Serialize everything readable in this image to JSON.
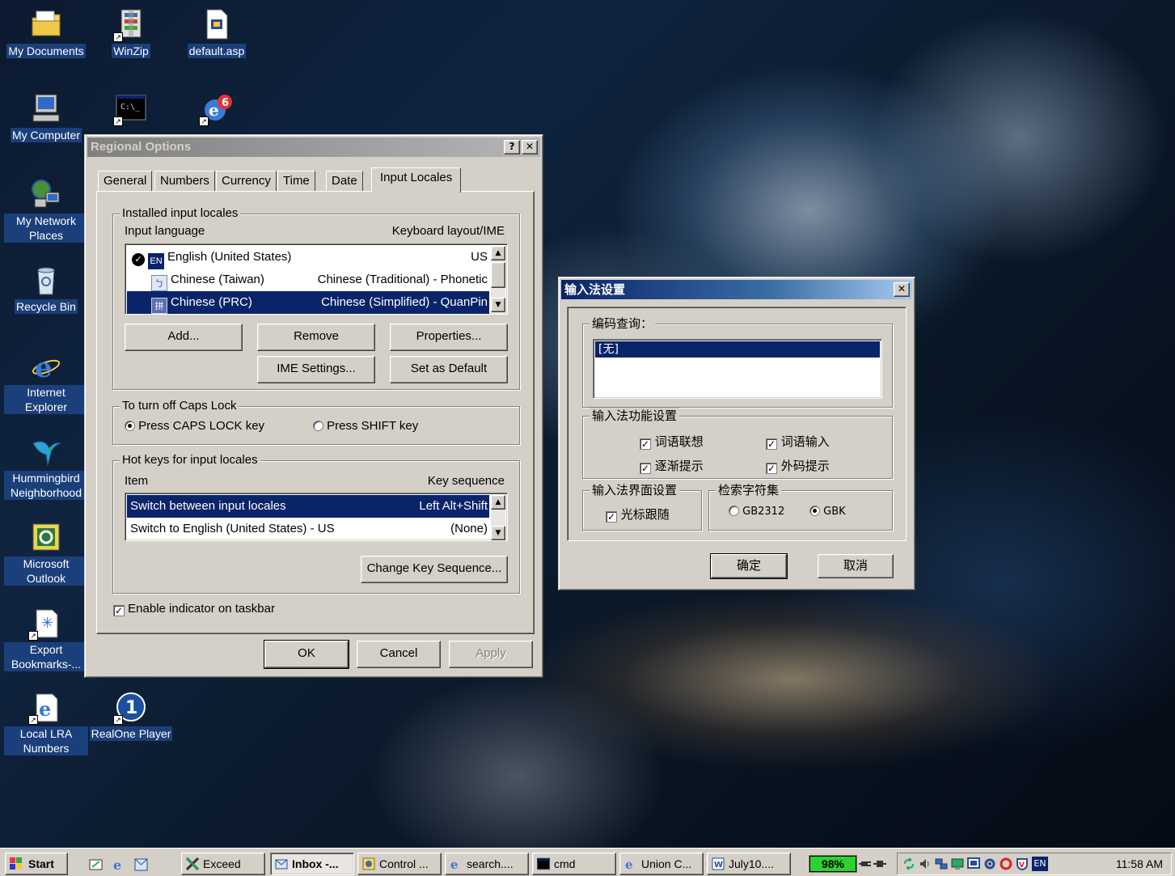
{
  "desktop": {
    "icons": [
      {
        "label": "My Documents"
      },
      {
        "label": "WinZip"
      },
      {
        "label": "default.asp"
      },
      {
        "label": "My Computer"
      },
      {
        "label": "C:\\_"
      },
      {
        "label": "My Network Places"
      },
      {
        "label": "Recycle Bin"
      },
      {
        "label": "Internet Explorer"
      },
      {
        "label": "Hummingbird Neighborhood"
      },
      {
        "label": "Microsoft Outlook"
      },
      {
        "label": "Export Bookmarks-..."
      },
      {
        "label": "Local LRA Numbers"
      },
      {
        "label": "RealOne Player"
      }
    ]
  },
  "regional": {
    "title": "Regional Options",
    "help_btn": "?",
    "close_btn": "✕",
    "tabs": [
      "General",
      "Numbers",
      "Currency",
      "Time",
      "Date",
      "Input Locales"
    ],
    "installed_group": "Installed input locales",
    "col_language": "Input language",
    "col_layout": "Keyboard layout/IME",
    "locales": [
      {
        "flag": "EN",
        "language": "English (United States)",
        "layout": "US",
        "default": true
      },
      {
        "flag": "",
        "language": "Chinese (Taiwan)",
        "layout": "Chinese (Traditional) - Phonetic"
      },
      {
        "flag": "",
        "language": "Chinese (PRC)",
        "layout": "Chinese (Simplified) - QuanPin"
      }
    ],
    "btn_add": "Add...",
    "btn_remove": "Remove",
    "btn_properties": "Properties...",
    "btn_ime": "IME Settings...",
    "btn_default": "Set as Default",
    "caps_group": "To turn off Caps Lock",
    "radio_caps": "Press CAPS LOCK key",
    "radio_shift": "Press SHIFT key",
    "hotkeys_group": "Hot keys for input locales",
    "col_item": "Item",
    "col_keyseq": "Key sequence",
    "hotkeys": [
      {
        "item": "Switch between input locales",
        "seq": "Left Alt+Shift"
      },
      {
        "item": "Switch to English (United States) - US",
        "seq": "(None)"
      }
    ],
    "btn_change_seq": "Change Key Sequence...",
    "enable_indicator": "Enable indicator on taskbar",
    "btn_ok": "OK",
    "btn_cancel": "Cancel",
    "btn_apply": "Apply"
  },
  "ime": {
    "title": "输入法设置",
    "close_btn": "✕",
    "query_group": "编码查询：",
    "query_items": [
      "[无]"
    ],
    "func_group": "输入法功能设置",
    "func_checks": [
      "词语联想",
      "词语输入",
      "逐渐提示",
      "外码提示"
    ],
    "ui_group": "输入法界面设置",
    "ui_check": "光标跟随",
    "charset_group": "检索字符集",
    "charset_gb2312": "GB2312",
    "charset_gbk": "GBK",
    "btn_ok": "确定",
    "btn_cancel": "取消"
  },
  "taskbar": {
    "start": "Start",
    "tasks": [
      "Exceed",
      "Inbox -...",
      "Control ...",
      "search....",
      "cmd",
      "Union C...",
      "July10...."
    ],
    "battery": "98%",
    "clock": "11:58 AM",
    "lang": "EN"
  }
}
